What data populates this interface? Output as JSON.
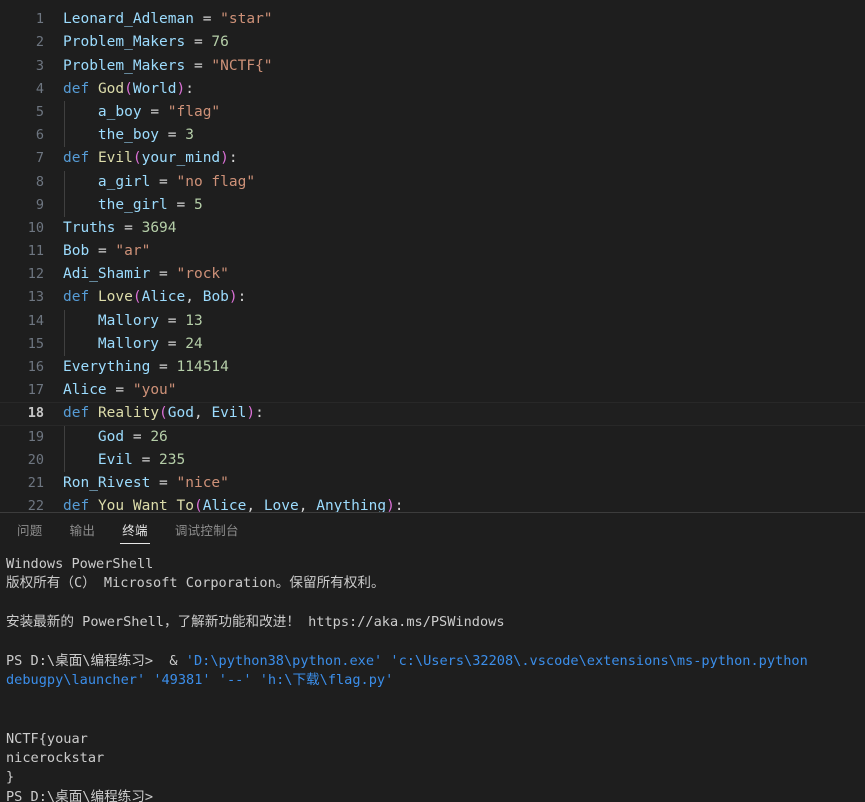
{
  "editor": {
    "language": "python",
    "current_line": 18,
    "colors": {
      "background": "#1e1e1e",
      "variable": "#9cdcfe",
      "keyword": "#569cd6",
      "function": "#dcdcaa",
      "string": "#ce9178",
      "number": "#b5cea8",
      "punctuation": "#d4d4d4",
      "line_number": "#6e7681",
      "line_number_active": "#c6c6c6"
    },
    "lines": [
      {
        "number": "",
        "indent": 0,
        "partial_top": true,
        "tokens": []
      },
      {
        "number": "1",
        "indent": 0,
        "tokens": [
          {
            "t": "var",
            "v": "Leonard_Adleman"
          },
          {
            "t": "plain",
            "v": " "
          },
          {
            "t": "op",
            "v": "="
          },
          {
            "t": "plain",
            "v": " "
          },
          {
            "t": "str",
            "v": "\"star\""
          }
        ]
      },
      {
        "number": "2",
        "indent": 0,
        "tokens": [
          {
            "t": "var",
            "v": "Problem_Makers"
          },
          {
            "t": "plain",
            "v": " "
          },
          {
            "t": "op",
            "v": "="
          },
          {
            "t": "plain",
            "v": " "
          },
          {
            "t": "num",
            "v": "76"
          }
        ]
      },
      {
        "number": "3",
        "indent": 0,
        "tokens": [
          {
            "t": "var",
            "v": "Problem_Makers"
          },
          {
            "t": "plain",
            "v": " "
          },
          {
            "t": "op",
            "v": "="
          },
          {
            "t": "plain",
            "v": " "
          },
          {
            "t": "str",
            "v": "\"NCTF{\""
          }
        ]
      },
      {
        "number": "4",
        "indent": 0,
        "tokens": [
          {
            "t": "kw",
            "v": "def"
          },
          {
            "t": "plain",
            "v": " "
          },
          {
            "t": "fn",
            "v": "God"
          },
          {
            "t": "paren",
            "v": "("
          },
          {
            "t": "var",
            "v": "World"
          },
          {
            "t": "paren",
            "v": ")"
          },
          {
            "t": "punc",
            "v": ":"
          }
        ]
      },
      {
        "number": "5",
        "indent": 1,
        "tokens": [
          {
            "t": "plain",
            "v": "    "
          },
          {
            "t": "var",
            "v": "a_boy"
          },
          {
            "t": "plain",
            "v": " "
          },
          {
            "t": "op",
            "v": "="
          },
          {
            "t": "plain",
            "v": " "
          },
          {
            "t": "str",
            "v": "\"flag\""
          }
        ]
      },
      {
        "number": "6",
        "indent": 1,
        "tokens": [
          {
            "t": "plain",
            "v": "    "
          },
          {
            "t": "var",
            "v": "the_boy"
          },
          {
            "t": "plain",
            "v": " "
          },
          {
            "t": "op",
            "v": "="
          },
          {
            "t": "plain",
            "v": " "
          },
          {
            "t": "num",
            "v": "3"
          }
        ]
      },
      {
        "number": "7",
        "indent": 0,
        "tokens": [
          {
            "t": "kw",
            "v": "def"
          },
          {
            "t": "plain",
            "v": " "
          },
          {
            "t": "fn",
            "v": "Evil"
          },
          {
            "t": "paren",
            "v": "("
          },
          {
            "t": "var",
            "v": "your_mind"
          },
          {
            "t": "paren",
            "v": ")"
          },
          {
            "t": "punc",
            "v": ":"
          }
        ]
      },
      {
        "number": "8",
        "indent": 1,
        "tokens": [
          {
            "t": "plain",
            "v": "    "
          },
          {
            "t": "var",
            "v": "a_girl"
          },
          {
            "t": "plain",
            "v": " "
          },
          {
            "t": "op",
            "v": "="
          },
          {
            "t": "plain",
            "v": " "
          },
          {
            "t": "str",
            "v": "\"no flag\""
          }
        ]
      },
      {
        "number": "9",
        "indent": 1,
        "tokens": [
          {
            "t": "plain",
            "v": "    "
          },
          {
            "t": "var",
            "v": "the_girl"
          },
          {
            "t": "plain",
            "v": " "
          },
          {
            "t": "op",
            "v": "="
          },
          {
            "t": "plain",
            "v": " "
          },
          {
            "t": "num",
            "v": "5"
          }
        ]
      },
      {
        "number": "10",
        "indent": 0,
        "tokens": [
          {
            "t": "var",
            "v": "Truths"
          },
          {
            "t": "plain",
            "v": " "
          },
          {
            "t": "op",
            "v": "="
          },
          {
            "t": "plain",
            "v": " "
          },
          {
            "t": "num",
            "v": "3694"
          }
        ]
      },
      {
        "number": "11",
        "indent": 0,
        "tokens": [
          {
            "t": "var",
            "v": "Bob"
          },
          {
            "t": "plain",
            "v": " "
          },
          {
            "t": "op",
            "v": "="
          },
          {
            "t": "plain",
            "v": " "
          },
          {
            "t": "str",
            "v": "\"ar\""
          }
        ]
      },
      {
        "number": "12",
        "indent": 0,
        "tokens": [
          {
            "t": "var",
            "v": "Adi_Shamir"
          },
          {
            "t": "plain",
            "v": " "
          },
          {
            "t": "op",
            "v": "="
          },
          {
            "t": "plain",
            "v": " "
          },
          {
            "t": "str",
            "v": "\"rock\""
          }
        ]
      },
      {
        "number": "13",
        "indent": 0,
        "tokens": [
          {
            "t": "kw",
            "v": "def"
          },
          {
            "t": "plain",
            "v": " "
          },
          {
            "t": "fn",
            "v": "Love"
          },
          {
            "t": "paren",
            "v": "("
          },
          {
            "t": "var",
            "v": "Alice"
          },
          {
            "t": "punc",
            "v": ","
          },
          {
            "t": "plain",
            "v": " "
          },
          {
            "t": "var",
            "v": "Bob"
          },
          {
            "t": "paren",
            "v": ")"
          },
          {
            "t": "punc",
            "v": ":"
          }
        ]
      },
      {
        "number": "14",
        "indent": 1,
        "tokens": [
          {
            "t": "plain",
            "v": "    "
          },
          {
            "t": "var",
            "v": "Mallory"
          },
          {
            "t": "plain",
            "v": " "
          },
          {
            "t": "op",
            "v": "="
          },
          {
            "t": "plain",
            "v": " "
          },
          {
            "t": "num",
            "v": "13"
          }
        ]
      },
      {
        "number": "15",
        "indent": 1,
        "tokens": [
          {
            "t": "plain",
            "v": "    "
          },
          {
            "t": "var",
            "v": "Mallory"
          },
          {
            "t": "plain",
            "v": " "
          },
          {
            "t": "op",
            "v": "="
          },
          {
            "t": "plain",
            "v": " "
          },
          {
            "t": "num",
            "v": "24"
          }
        ]
      },
      {
        "number": "16",
        "indent": 0,
        "tokens": [
          {
            "t": "var",
            "v": "Everything"
          },
          {
            "t": "plain",
            "v": " "
          },
          {
            "t": "op",
            "v": "="
          },
          {
            "t": "plain",
            "v": " "
          },
          {
            "t": "num",
            "v": "114514"
          }
        ]
      },
      {
        "number": "17",
        "indent": 0,
        "tokens": [
          {
            "t": "var",
            "v": "Alice"
          },
          {
            "t": "plain",
            "v": " "
          },
          {
            "t": "op",
            "v": "="
          },
          {
            "t": "plain",
            "v": " "
          },
          {
            "t": "str",
            "v": "\"you\""
          }
        ]
      },
      {
        "number": "18",
        "indent": 0,
        "current": true,
        "tokens": [
          {
            "t": "kw",
            "v": "def"
          },
          {
            "t": "plain",
            "v": " "
          },
          {
            "t": "fn",
            "v": "Reality"
          },
          {
            "t": "paren",
            "v": "("
          },
          {
            "t": "var",
            "v": "God"
          },
          {
            "t": "punc",
            "v": ","
          },
          {
            "t": "plain",
            "v": " "
          },
          {
            "t": "var",
            "v": "Evil"
          },
          {
            "t": "paren",
            "v": ")"
          },
          {
            "t": "punc",
            "v": ":"
          }
        ]
      },
      {
        "number": "19",
        "indent": 1,
        "tokens": [
          {
            "t": "plain",
            "v": "    "
          },
          {
            "t": "var",
            "v": "God"
          },
          {
            "t": "plain",
            "v": " "
          },
          {
            "t": "op",
            "v": "="
          },
          {
            "t": "plain",
            "v": " "
          },
          {
            "t": "num",
            "v": "26"
          }
        ]
      },
      {
        "number": "20",
        "indent": 1,
        "tokens": [
          {
            "t": "plain",
            "v": "    "
          },
          {
            "t": "var",
            "v": "Evil"
          },
          {
            "t": "plain",
            "v": " "
          },
          {
            "t": "op",
            "v": "="
          },
          {
            "t": "plain",
            "v": " "
          },
          {
            "t": "num",
            "v": "235"
          }
        ]
      },
      {
        "number": "21",
        "indent": 0,
        "tokens": [
          {
            "t": "var",
            "v": "Ron_Rivest"
          },
          {
            "t": "plain",
            "v": " "
          },
          {
            "t": "op",
            "v": "="
          },
          {
            "t": "plain",
            "v": " "
          },
          {
            "t": "str",
            "v": "\"nice\""
          }
        ]
      },
      {
        "number": "22",
        "indent": 0,
        "tokens": [
          {
            "t": "kw",
            "v": "def"
          },
          {
            "t": "plain",
            "v": " "
          },
          {
            "t": "fn",
            "v": "You_Want_To"
          },
          {
            "t": "paren",
            "v": "("
          },
          {
            "t": "var",
            "v": "Alice"
          },
          {
            "t": "punc",
            "v": ","
          },
          {
            "t": "plain",
            "v": " "
          },
          {
            "t": "var",
            "v": "Love"
          },
          {
            "t": "punc",
            "v": ","
          },
          {
            "t": "plain",
            "v": " "
          },
          {
            "t": "var",
            "v": "Anything"
          },
          {
            "t": "paren",
            "v": ")"
          },
          {
            "t": "punc",
            "v": ":"
          }
        ]
      },
      {
        "number": "",
        "indent": 1,
        "partial_bottom": true,
        "tokens": []
      }
    ]
  },
  "panel": {
    "tabs": [
      {
        "label": "问题",
        "name": "tab-problems",
        "active": false
      },
      {
        "label": "输出",
        "name": "tab-output",
        "active": false
      },
      {
        "label": "终端",
        "name": "tab-terminal",
        "active": true
      },
      {
        "label": "调试控制台",
        "name": "tab-debug-console",
        "active": false
      }
    ],
    "terminal": {
      "lines": [
        {
          "type": "text",
          "segments": [
            {
              "c": "white",
              "v": "Windows PowerShell"
            }
          ]
        },
        {
          "type": "text",
          "segments": [
            {
              "c": "white",
              "v": "版权所有（C） Microsoft Corporation。保留所有权利。"
            }
          ]
        },
        {
          "type": "blank",
          "segments": []
        },
        {
          "type": "text",
          "segments": [
            {
              "c": "white",
              "v": "安装最新的 PowerShell，了解新功能和改进！ https://aka.ms/PSWindows"
            }
          ]
        },
        {
          "type": "blank",
          "segments": []
        },
        {
          "type": "command",
          "segments": [
            {
              "c": "white",
              "v": "PS D:\\桌面\\编程练习>  & "
            },
            {
              "c": "cyan",
              "v": "'D:\\python38\\python.exe' 'c:\\Users\\32208\\.vscode\\extensions\\ms-python.python"
            }
          ]
        },
        {
          "type": "command",
          "segments": [
            {
              "c": "cyan",
              "v": "debugpy\\launcher' '49381' '--' 'h:\\下载\\flag.py'"
            }
          ]
        },
        {
          "type": "blank",
          "segments": []
        },
        {
          "type": "blank",
          "segments": []
        },
        {
          "type": "text",
          "segments": [
            {
              "c": "white",
              "v": "NCTF{youar"
            }
          ]
        },
        {
          "type": "text",
          "segments": [
            {
              "c": "white",
              "v": "nicerockstar"
            }
          ]
        },
        {
          "type": "text",
          "segments": [
            {
              "c": "white",
              "v": "}"
            }
          ]
        },
        {
          "type": "text",
          "segments": [
            {
              "c": "white",
              "v": "PS D:\\桌面\\编程练习>"
            }
          ]
        }
      ]
    }
  }
}
